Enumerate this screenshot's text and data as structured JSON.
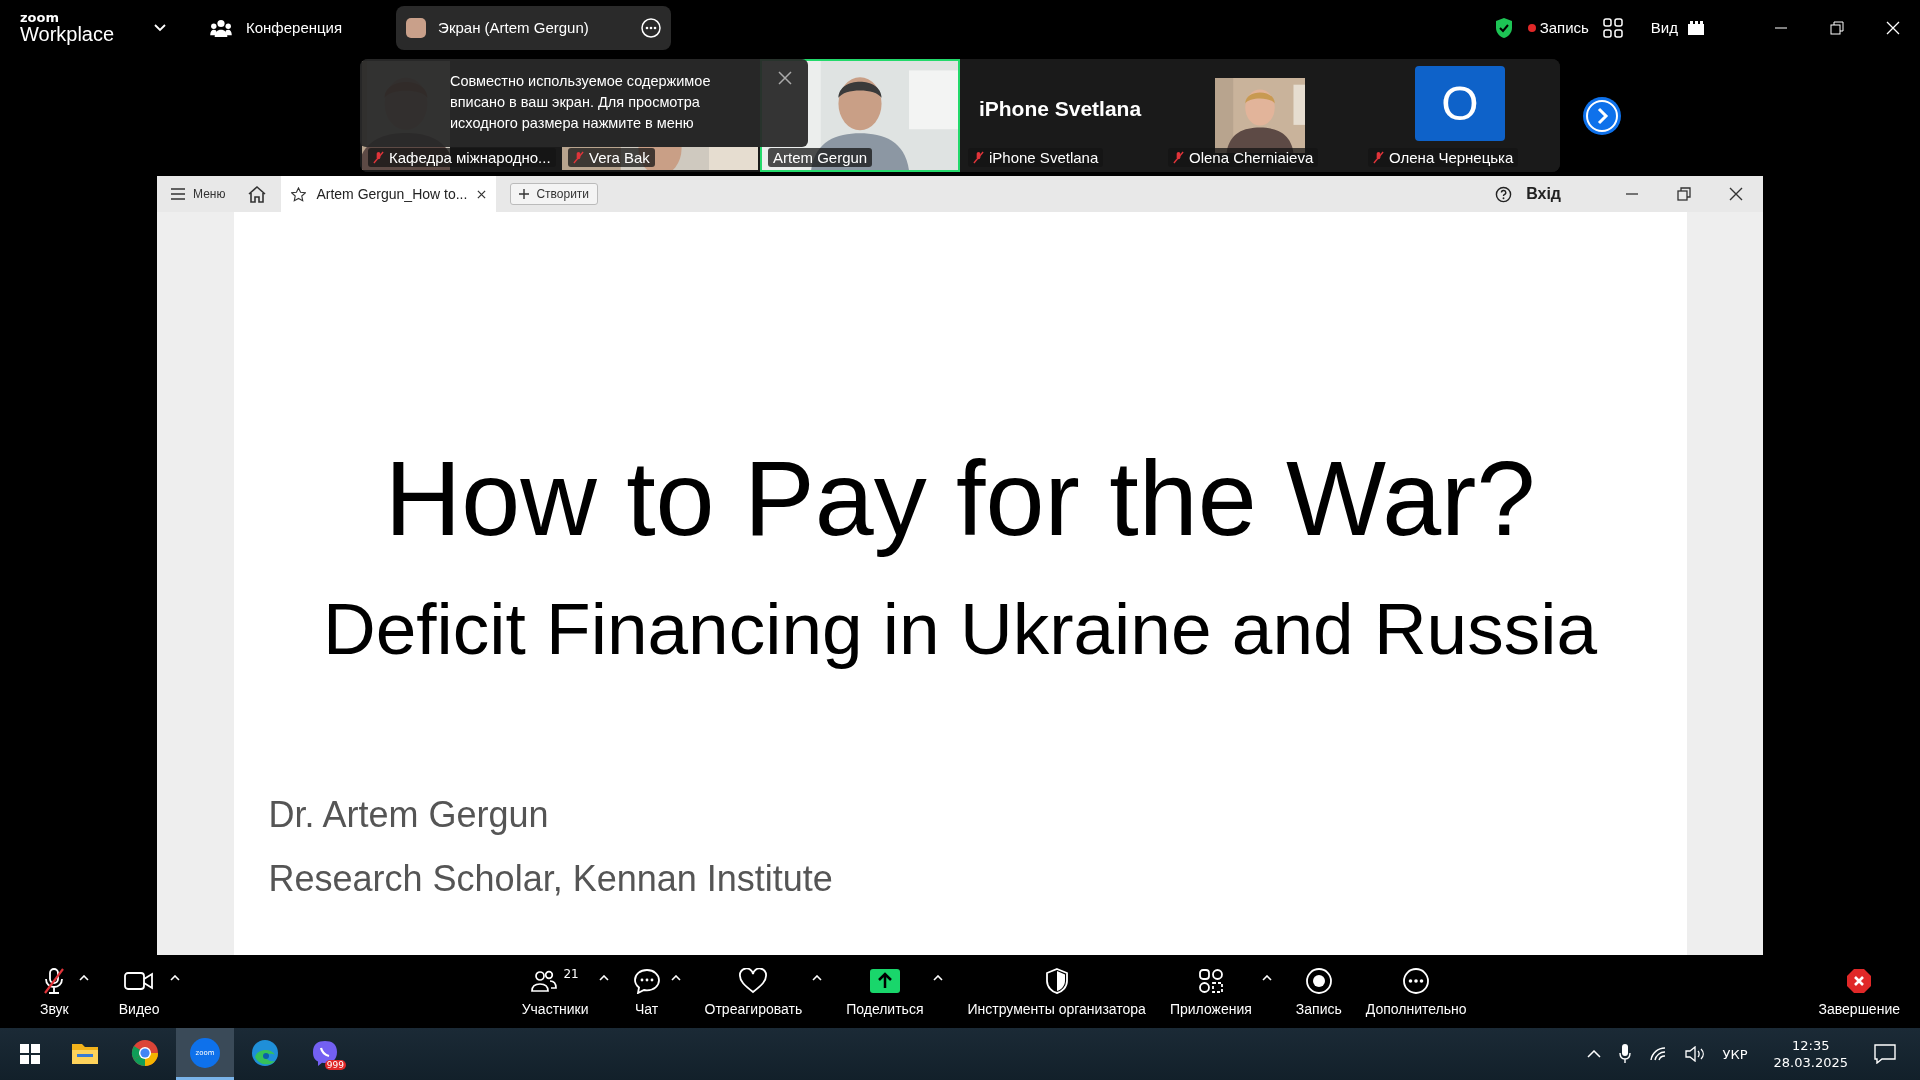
{
  "top_bar": {
    "logo_small": "zoom",
    "logo": "Workplace",
    "meeting": "Конференция",
    "share_pill": "Экран (Artem Gergun)",
    "recording": "Запись",
    "view": "Вид"
  },
  "notice": "Совместно используемое содержимое вписано в ваш экран. Для просмотра исходного размера нажмите в меню",
  "participants": [
    {
      "name": "Кафедра міжнародно...",
      "kind": "picture",
      "muted": true,
      "speaking": false
    },
    {
      "name": "Vera Bak",
      "kind": "picture",
      "muted": true,
      "speaking": false
    },
    {
      "name": "Artem Gergun",
      "kind": "picture",
      "muted": false,
      "speaking": true
    },
    {
      "name": "iPhone Svetlana",
      "kind": "name",
      "tile_text": "iPhone Svetlana",
      "muted": true,
      "speaking": false
    },
    {
      "name": "Olena Cherniaieva",
      "muted": true,
      "speaking": false
    },
    {
      "name": "Олена Чернецька",
      "kind": "avatar",
      "tile_text": "О",
      "muted": true,
      "speaking": false
    }
  ],
  "shared_app": {
    "menu": "Меню",
    "tab": "Artem Gergun_How to...",
    "create": "Створити",
    "login": "Вхід"
  },
  "slide": {
    "title": "How to Pay for the War?",
    "subtitle": "Deficit Financing in Ukraine and Russia",
    "author": "Dr. Artem Gergun",
    "affiliation": "Research Scholar, Kennan Institute"
  },
  "toolbar": [
    {
      "kind": "mic",
      "label": "Звук",
      "caret": true,
      "muted": true
    },
    {
      "kind": "video",
      "label": "Видео",
      "caret": true
    },
    {
      "kind": "participants",
      "label": "Участники",
      "count": "21",
      "caret": true
    },
    {
      "kind": "chat",
      "label": "Чат",
      "caret": true
    },
    {
      "kind": "react",
      "label": "Отреагировать",
      "caret": true
    },
    {
      "kind": "share",
      "label": "Поделиться",
      "caret": true
    },
    {
      "kind": "security",
      "label": "Инструменты организатора",
      "caret": false
    },
    {
      "kind": "apps",
      "label": "Приложения",
      "caret": true
    },
    {
      "kind": "record",
      "label": "Запись",
      "caret": false
    },
    {
      "kind": "more",
      "label": "Дополнительно",
      "caret": false
    },
    {
      "kind": "end",
      "label": "Завершение",
      "caret": false
    }
  ],
  "taskbar": {
    "apps": [
      {
        "kind": "explorer",
        "selected": false
      },
      {
        "kind": "chrome",
        "selected": false
      },
      {
        "kind": "zoom",
        "label": "zoom",
        "selected": true
      },
      {
        "kind": "edge",
        "selected": false
      },
      {
        "kind": "viber",
        "badge": "999",
        "selected": false
      }
    ],
    "language": "УКР",
    "time": "12:35",
    "date": "28.03.2025"
  }
}
